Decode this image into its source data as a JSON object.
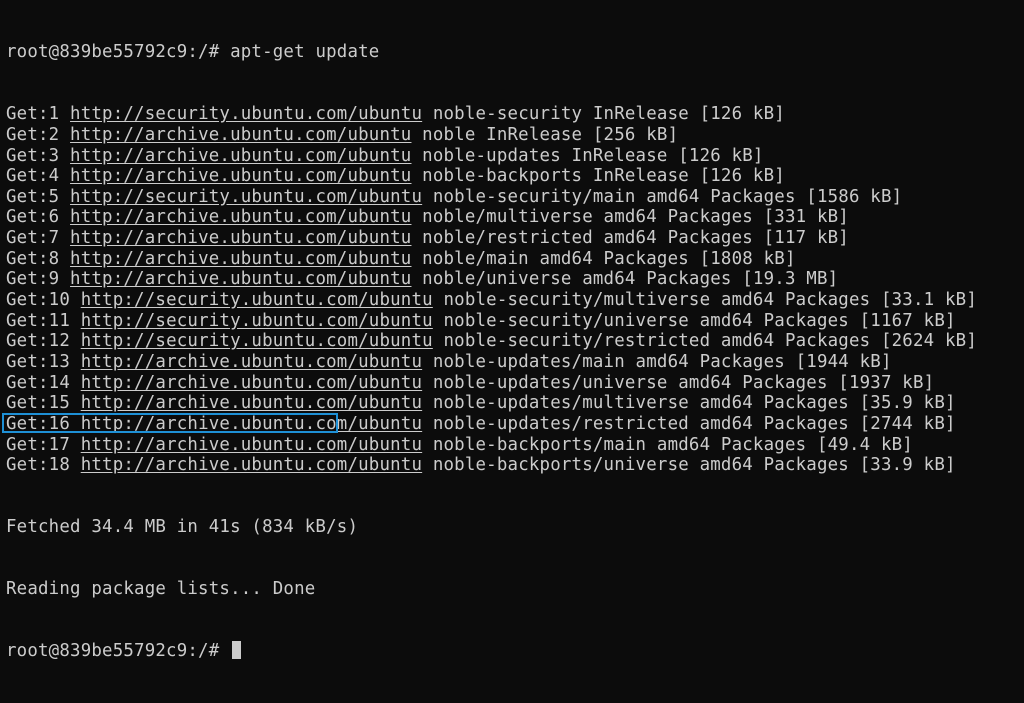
{
  "terminal": {
    "command_line": {
      "prompt": "root@839be55792c9:/#",
      "command": "apt-get update"
    },
    "get_lines": [
      {
        "prefix": "Get:1",
        "url": "http://security.ubuntu.com/ubuntu",
        "info": "noble-security InRelease [126 kB]"
      },
      {
        "prefix": "Get:2",
        "url": "http://archive.ubuntu.com/ubuntu",
        "info": "noble InRelease [256 kB]"
      },
      {
        "prefix": "Get:3",
        "url": "http://archive.ubuntu.com/ubuntu",
        "info": "noble-updates InRelease [126 kB]"
      },
      {
        "prefix": "Get:4",
        "url": "http://archive.ubuntu.com/ubuntu",
        "info": "noble-backports InRelease [126 kB]"
      },
      {
        "prefix": "Get:5",
        "url": "http://security.ubuntu.com/ubuntu",
        "info": "noble-security/main amd64 Packages [1586 kB]"
      },
      {
        "prefix": "Get:6",
        "url": "http://archive.ubuntu.com/ubuntu",
        "info": "noble/multiverse amd64 Packages [331 kB]"
      },
      {
        "prefix": "Get:7",
        "url": "http://archive.ubuntu.com/ubuntu",
        "info": "noble/restricted amd64 Packages [117 kB]"
      },
      {
        "prefix": "Get:8",
        "url": "http://archive.ubuntu.com/ubuntu",
        "info": "noble/main amd64 Packages [1808 kB]"
      },
      {
        "prefix": "Get:9",
        "url": "http://archive.ubuntu.com/ubuntu",
        "info": "noble/universe amd64 Packages [19.3 MB]"
      },
      {
        "prefix": "Get:10",
        "url": "http://security.ubuntu.com/ubuntu",
        "info": "noble-security/multiverse amd64 Packages [33.1 kB]"
      },
      {
        "prefix": "Get:11",
        "url": "http://security.ubuntu.com/ubuntu",
        "info": "noble-security/universe amd64 Packages [1167 kB]"
      },
      {
        "prefix": "Get:12",
        "url": "http://security.ubuntu.com/ubuntu",
        "info": "noble-security/restricted amd64 Packages [2624 kB]"
      },
      {
        "prefix": "Get:13",
        "url": "http://archive.ubuntu.com/ubuntu",
        "info": "noble-updates/main amd64 Packages [1944 kB]"
      },
      {
        "prefix": "Get:14",
        "url": "http://archive.ubuntu.com/ubuntu",
        "info": "noble-updates/universe amd64 Packages [1937 kB]"
      },
      {
        "prefix": "Get:15",
        "url": "http://archive.ubuntu.com/ubuntu",
        "info": "noble-updates/multiverse amd64 Packages [35.9 kB]"
      },
      {
        "prefix": "Get:16",
        "url": "http://archive.ubuntu.com/ubuntu",
        "info": "noble-updates/restricted amd64 Packages [2744 kB]"
      },
      {
        "prefix": "Get:17",
        "url": "http://archive.ubuntu.com/ubuntu",
        "info": "noble-backports/main amd64 Packages [49.4 kB]"
      },
      {
        "prefix": "Get:18",
        "url": "http://archive.ubuntu.com/ubuntu",
        "info": "noble-backports/universe amd64 Packages [33.9 kB]"
      }
    ],
    "fetched_line": "Fetched 34.4 MB in 41s (834 kB/s)",
    "reading_line": "Reading package lists... Done",
    "final_prompt": "root@839be55792c9:/#"
  },
  "colors": {
    "background": "#0c0c0c",
    "text": "#cccccc",
    "highlight_border": "#1e90d6"
  }
}
